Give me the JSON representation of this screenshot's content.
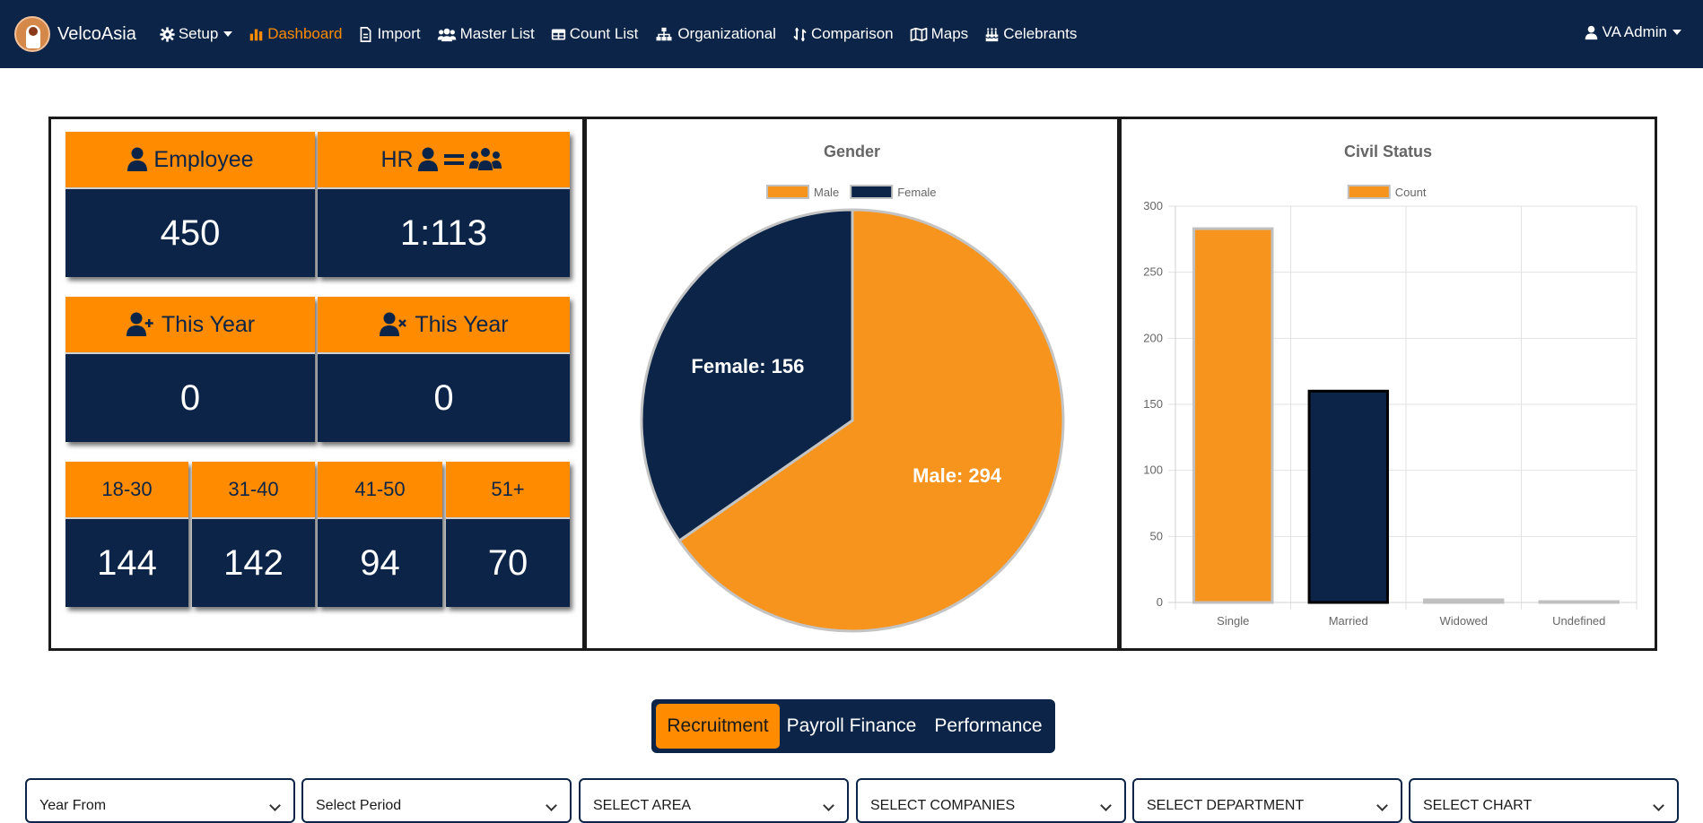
{
  "brand": {
    "name": "VelcoAsia"
  },
  "nav": {
    "setup": "Setup",
    "dashboard": "Dashboard",
    "import": "Import",
    "master_list": "Master List",
    "count_list": "Count List",
    "organizational": "Organizational",
    "comparison": "Comparison",
    "maps": "Maps",
    "celebrants": "Celebrants",
    "user": "VA Admin"
  },
  "stats": {
    "employee": {
      "label": "Employee",
      "value": "450"
    },
    "hr_ratio": {
      "label": "HR",
      "value": "1:113"
    },
    "hired_this_year": {
      "label": "This Year",
      "value": "0"
    },
    "separated_this_year": {
      "label": "This Year",
      "value": "0"
    },
    "age_groups": [
      {
        "label": "18-30",
        "value": "144"
      },
      {
        "label": "31-40",
        "value": "142"
      },
      {
        "label": "41-50",
        "value": "94"
      },
      {
        "label": "51+",
        "value": "70"
      }
    ]
  },
  "colors": {
    "navy": "#0b2447",
    "orange": "#ff8c00",
    "chart_orange": "#f7941d"
  },
  "chart_data": [
    {
      "type": "pie",
      "title": "Gender",
      "legend": "top",
      "categories": [
        "Male",
        "Female"
      ],
      "values": [
        294,
        156
      ],
      "data_labels": [
        "Male: 294",
        "Female: 156"
      ],
      "colors": [
        "#f7941d",
        "#0b2447"
      ]
    },
    {
      "type": "bar",
      "title": "Civil Status",
      "legend": "top",
      "series": [
        {
          "name": "Count",
          "values": [
            283,
            160,
            2,
            0
          ]
        }
      ],
      "categories": [
        "Single",
        "Married",
        "Widowed",
        "Undefined"
      ],
      "ylim": [
        0,
        300
      ],
      "yticks": [
        0,
        50,
        100,
        150,
        200,
        250,
        300
      ],
      "grid": true,
      "bar_colors": [
        "#f7941d",
        "#0b2447",
        "#f7941d",
        "#f7941d"
      ]
    }
  ],
  "tabs": [
    "Recruitment",
    "Payroll Finance",
    "Performance"
  ],
  "filters": [
    "Year From",
    "Select Period",
    "SELECT AREA",
    "SELECT COMPANIES",
    "SELECT DEPARTMENT",
    "SELECT CHART"
  ]
}
